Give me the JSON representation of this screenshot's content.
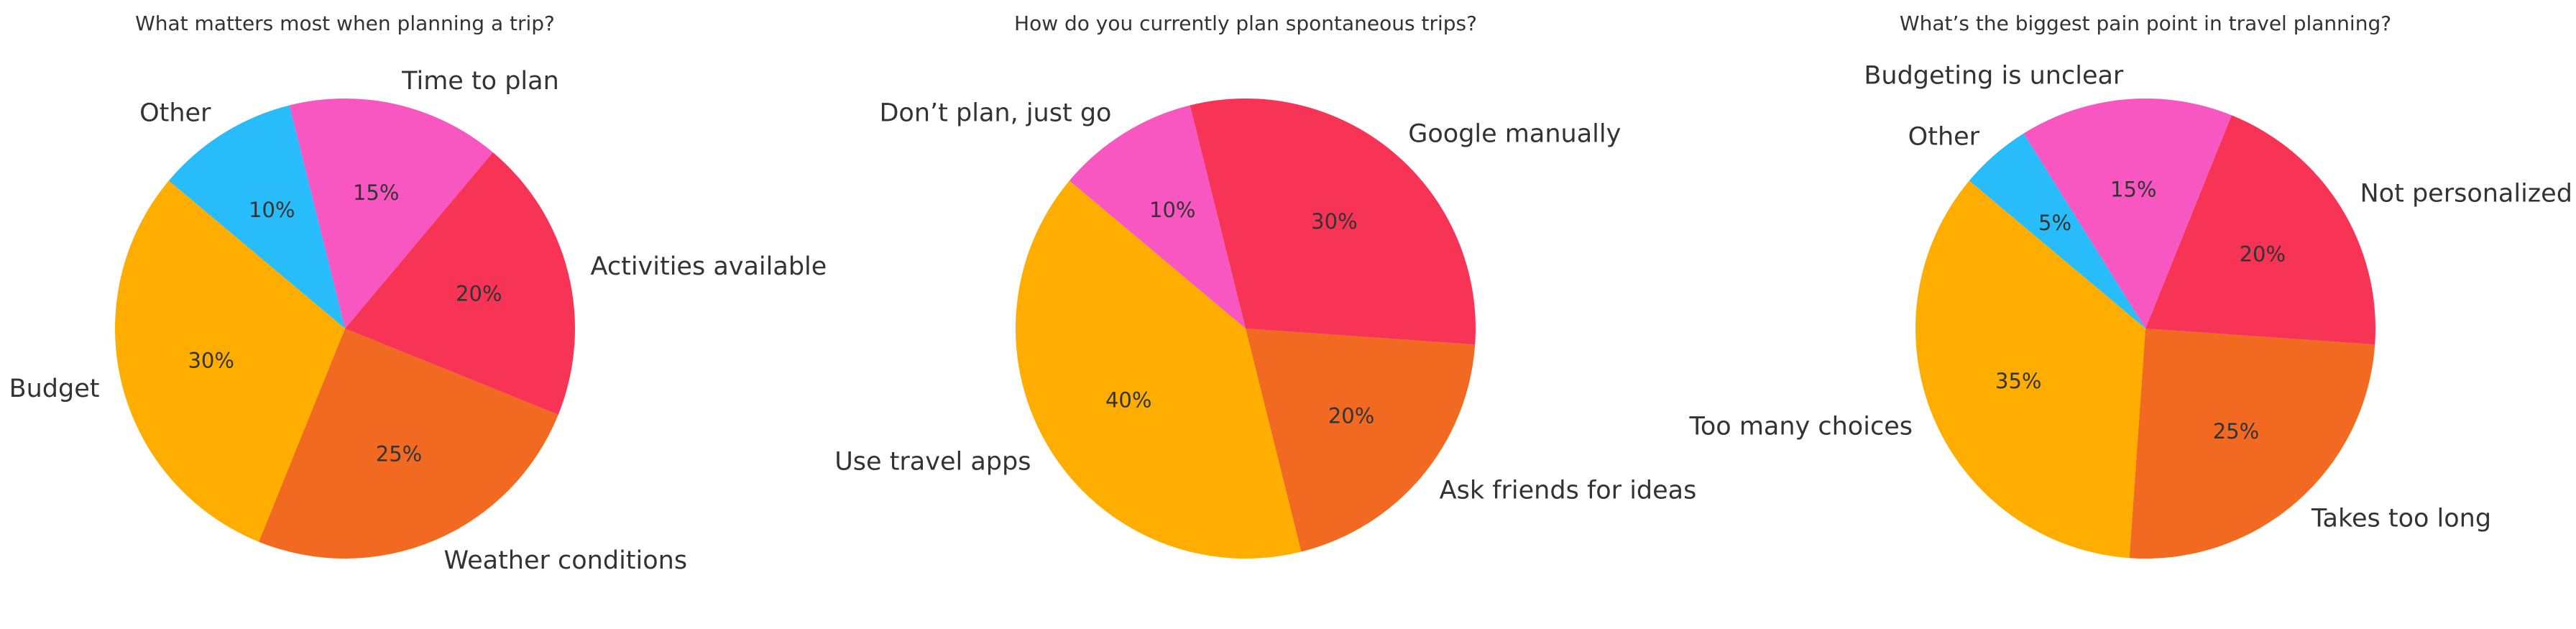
{
  "chart_data": [
    {
      "type": "pie",
      "title": "What matters most when planning a trip?",
      "labels": [
        "Budget",
        "Weather conditions",
        "Activities available",
        "Time to plan",
        "Other"
      ],
      "values": [
        30,
        25,
        20,
        15,
        10
      ],
      "pct_labels": [
        "30%",
        "25%",
        "20%",
        "15%",
        "10%"
      ],
      "colors": [
        "#FFAE00",
        "#F26A22",
        "#F73356",
        "#F857C1",
        "#29BCFB"
      ],
      "startangle": 140,
      "direction": "counterclockwise"
    },
    {
      "type": "pie",
      "title": "How do you currently plan spontaneous trips?",
      "labels": [
        "Use travel apps",
        "Ask friends for ideas",
        "Google manually",
        "Don’t plan, just go"
      ],
      "values": [
        40,
        20,
        30,
        10
      ],
      "pct_labels": [
        "40%",
        "20%",
        "30%",
        "10%"
      ],
      "colors": [
        "#FFAE00",
        "#F26A22",
        "#F73356",
        "#F857C1"
      ],
      "startangle": 140,
      "direction": "counterclockwise"
    },
    {
      "type": "pie",
      "title": "What’s the biggest pain point in travel planning?",
      "labels": [
        "Too many choices",
        "Takes too long",
        "Not personalized",
        "Budgeting is unclear",
        "Other"
      ],
      "values": [
        35,
        25,
        20,
        15,
        5
      ],
      "pct_labels": [
        "35%",
        "25%",
        "20%",
        "15%",
        "5%"
      ],
      "colors": [
        "#FFAE00",
        "#F26A22",
        "#F73356",
        "#F857C1",
        "#29BCFB"
      ],
      "startangle": 140,
      "direction": "counterclockwise"
    }
  ]
}
